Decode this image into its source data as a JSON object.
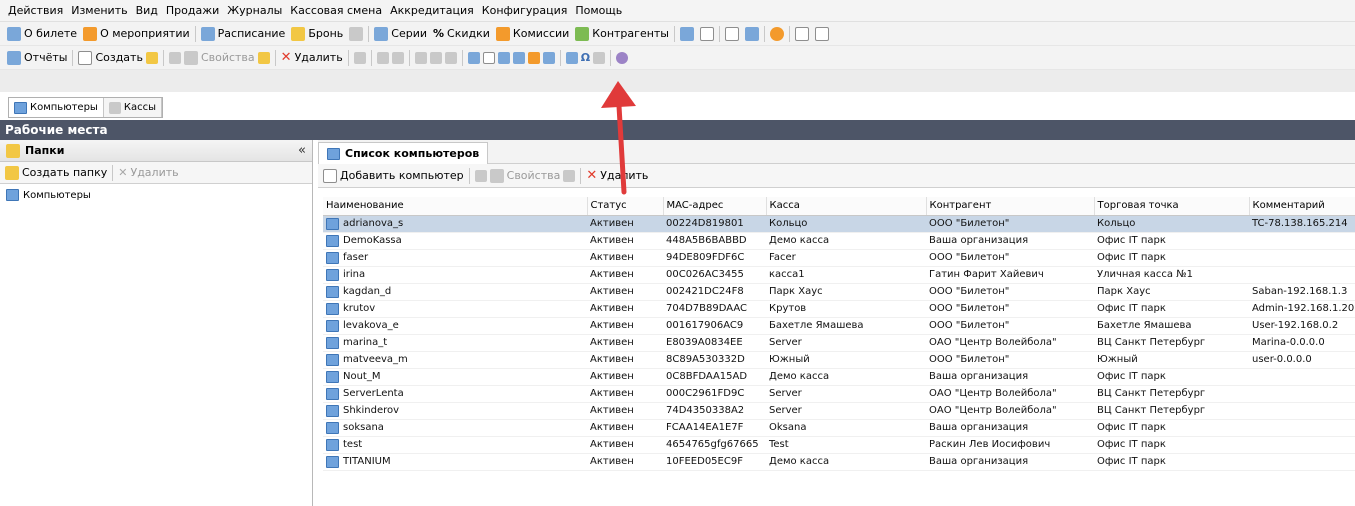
{
  "menu": [
    "Действия",
    "Изменить",
    "Вид",
    "Продажи",
    "Журналы",
    "Кассовая смена",
    "Аккредитация",
    "Конфигурация",
    "Помощь"
  ],
  "toolbar1": {
    "about_ticket": "О билете",
    "about_event": "О мероприятии",
    "schedule": "Расписание",
    "booking": "Бронь",
    "series": "Серии",
    "discounts": "Скидки",
    "commissions": "Комиссии",
    "counterparties": "Контрагенты"
  },
  "toolbar2": {
    "reports": "Отчёты",
    "create": "Создать",
    "properties": "Свойства",
    "delete": "Удалить"
  },
  "tabs": {
    "computers": "Компьютеры",
    "cashdesks": "Кассы"
  },
  "section_title": "Рабочие места",
  "left_panel": {
    "header": "Папки",
    "collapse": "«",
    "create_folder": "Создать папку",
    "delete": "Удалить",
    "tree_root": "Компьютеры"
  },
  "right_panel": {
    "title": "Список компьютеров",
    "add_computer": "Добавить компьютер",
    "properties": "Свойства",
    "delete": "Удалить"
  },
  "table": {
    "columns": [
      "Наименование",
      "Статус",
      "MAC-адрес",
      "Касса",
      "Контрагент",
      "Торговая точка",
      "Комментарий"
    ],
    "rows": [
      [
        "adrianova_s",
        "Активен",
        "00224D819801",
        "Кольцо",
        "ООО \"Билетон\"",
        "Кольцо",
        "TC-78.138.165.214"
      ],
      [
        "DemoKassa",
        "Активен",
        "448A5B6BABBD",
        "Демо касса",
        "Ваша организация",
        "Офис IT парк",
        ""
      ],
      [
        "faser",
        "Активен",
        "94DE809FDF6C",
        "Facer",
        "ООО \"Билетон\"",
        "Офис IT парк",
        ""
      ],
      [
        "irina",
        "Активен",
        "00C026AC3455",
        "касса1",
        "Гатин Фарит Хайевич",
        "Уличная касса №1",
        ""
      ],
      [
        "kagdan_d",
        "Активен",
        "002421DC24F8",
        "Парк Хаус",
        "ООО \"Билетон\"",
        "Парк Хаус",
        "Saban-192.168.1.3"
      ],
      [
        "krutov",
        "Активен",
        "704D7B89DAAC",
        "Крутов",
        "ООО \"Билетон\"",
        "Офис IT парк",
        "Admin-192.168.1.20"
      ],
      [
        "levakova_e",
        "Активен",
        "001617906AC9",
        "Бахетле Ямашева",
        "ООО \"Билетон\"",
        "Бахетле Ямашева",
        "User-192.168.0.2"
      ],
      [
        "marina_t",
        "Активен",
        "E8039A0834EE",
        "Server",
        "ОАО \"Центр Волейбола\"",
        "ВЦ Санкт Петербург",
        "Marina-0.0.0.0"
      ],
      [
        "matveeva_m",
        "Активен",
        "8C89A530332D",
        "Южный",
        "ООО \"Билетон\"",
        "Южный",
        "user-0.0.0.0"
      ],
      [
        "Nout_M",
        "Активен",
        "0C8BFDAA15AD",
        "Демо касса",
        "Ваша организация",
        "Офис IT парк",
        ""
      ],
      [
        "ServerLenta",
        "Активен",
        "000C2961FD9C",
        "Server",
        "ОАО \"Центр Волейбола\"",
        "ВЦ Санкт Петербург",
        ""
      ],
      [
        "Shkinderov",
        "Активен",
        "74D4350338A2",
        "Server",
        "ОАО \"Центр Волейбола\"",
        "ВЦ Санкт Петербург",
        ""
      ],
      [
        "soksana",
        "Активен",
        "FCAA14EA1E7F",
        "Oksana",
        "Ваша организация",
        "Офис IT парк",
        ""
      ],
      [
        "test",
        "Активен",
        "4654765gfg67665",
        "Test",
        "Раскин Лев Иосифович",
        "Офис IT парк",
        ""
      ],
      [
        "TITANIUM",
        "Активен",
        "10FEED05EC9F",
        "Демо касса",
        "Ваша организация",
        "Офис IT парк",
        ""
      ]
    ]
  },
  "colors": {
    "header_bg": "#4d5567",
    "selected_row": "#c8d6e6",
    "arrow": "#e03a3a"
  }
}
